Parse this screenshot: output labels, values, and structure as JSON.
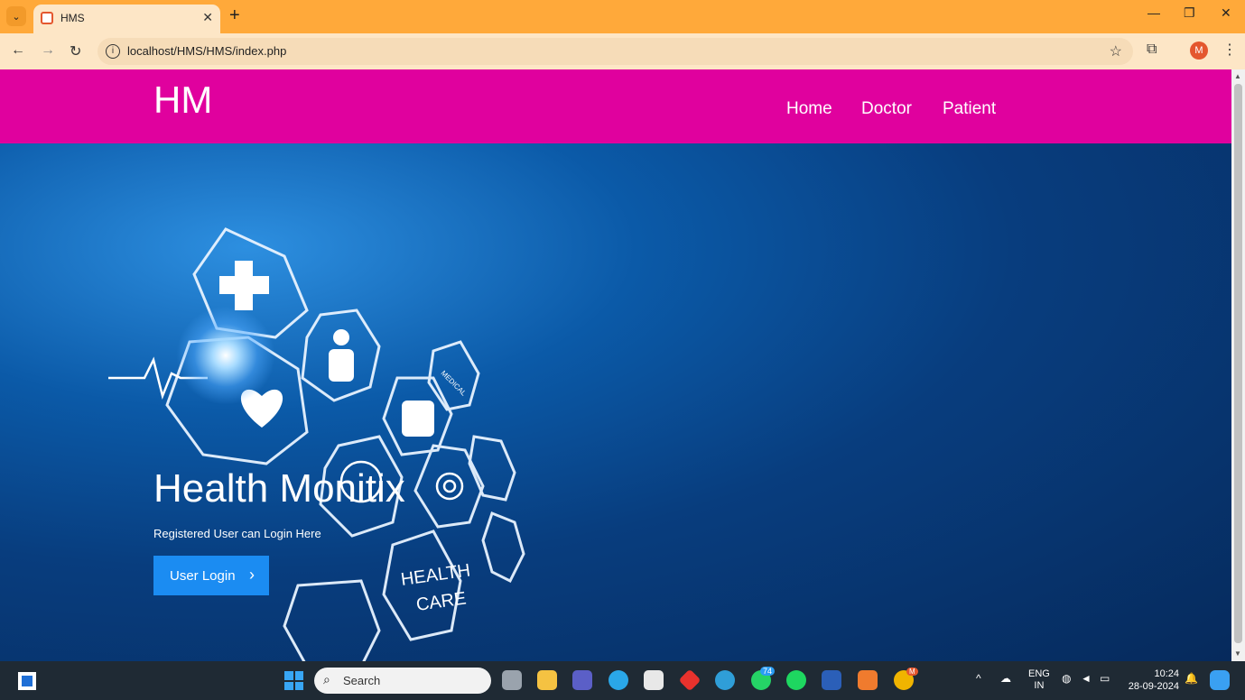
{
  "browser": {
    "tab_title": "HMS",
    "url": "localhost/HMS/HMS/index.php",
    "profile_initial": "M",
    "colors": {
      "tabbar": "#ffa93a",
      "toolbar": "#fde6c6"
    }
  },
  "site": {
    "brand": "HM",
    "nav": [
      {
        "label": "Home"
      },
      {
        "label": "Doctor"
      },
      {
        "label": "Patient"
      }
    ],
    "header_color": "#e0019e"
  },
  "hero": {
    "title": "Health Monitix",
    "subtitle": "Registered User can Login Here",
    "button_label": "User Login",
    "button_color": "#1b8cf2",
    "art_labels": [
      "HEALTH",
      "CARE",
      "MEDICAL"
    ]
  },
  "taskbar": {
    "search_placeholder": "Search",
    "whatsapp_badge": "74",
    "chrome_badge": "M",
    "lang_line1": "ENG",
    "lang_line2": "IN",
    "time": "10:24",
    "date": "28-09-2024"
  }
}
